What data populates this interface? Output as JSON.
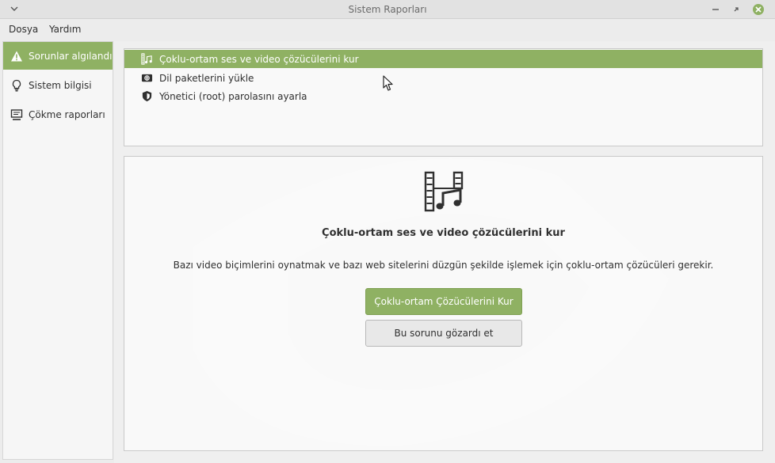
{
  "window": {
    "title": "Sistem Raporları"
  },
  "menubar": {
    "file": "Dosya",
    "help": "Yardım"
  },
  "sidebar": {
    "items": [
      {
        "label": "Sorunlar algılandı",
        "icon": "warning-icon",
        "active": true
      },
      {
        "label": "Sistem bilgisi",
        "icon": "lightbulb-icon",
        "active": false
      },
      {
        "label": "Çökme raporları",
        "icon": "monitor-icon",
        "active": false
      }
    ]
  },
  "problems": {
    "items": [
      {
        "label": "Çoklu-ortam ses ve video çözücülerini kur",
        "icon": "multimedia-icon",
        "selected": true
      },
      {
        "label": "Dil paketlerini yükle",
        "icon": "language-icon",
        "selected": false
      },
      {
        "label": "Yönetici (root) parolasını ayarla",
        "icon": "shield-icon",
        "selected": false
      }
    ]
  },
  "detail": {
    "icon": "multimedia-codecs-icon",
    "title": "Çoklu-ortam ses ve video çözücülerini kur",
    "description": "Bazı video biçimlerini oynatmak ve bazı web sitelerini düzgün şekilde işlemek için çoklu-ortam çözücüleri gerekir.",
    "install_button": "Çoklu-ortam Çözücülerini Kur",
    "ignore_button": "Bu sorunu gözardı et"
  },
  "colors": {
    "accent": "#8fb163",
    "titlebar": "#e2e2e2",
    "close": "#8fb163"
  }
}
